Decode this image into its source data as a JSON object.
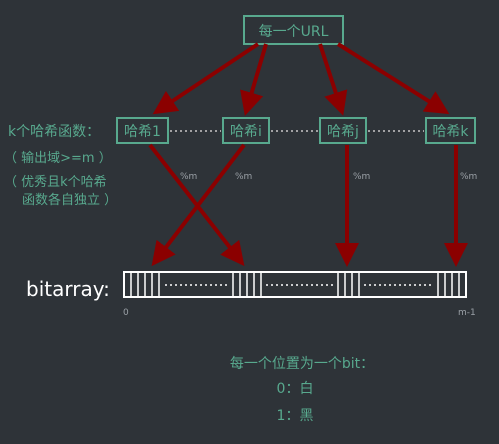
{
  "url_box": "每一个URL",
  "hash_boxes": [
    "哈希1",
    "哈希i",
    "哈希j",
    "哈希k"
  ],
  "left_label": {
    "line1": "k个哈希函数：",
    "line2": "（ 输出域>=m ）",
    "line3": "（ 优秀且k个哈希",
    "line4": "函数各自独立 ）"
  },
  "modulo_labels": [
    "%m",
    "%m",
    "%m",
    "%m"
  ],
  "bitarray_label": "bitarray:",
  "axis_start": "0",
  "axis_end": "m-1",
  "legend": {
    "line1": "每一个位置为一个bit：",
    "line2": "0：白",
    "line3": "1：黑"
  },
  "colors": {
    "background": "#2e3338",
    "accent_green": "#58a98e",
    "arrow_red": "#8b0000",
    "text_grey": "#9aa0a6",
    "text_white": "#ffffff"
  }
}
